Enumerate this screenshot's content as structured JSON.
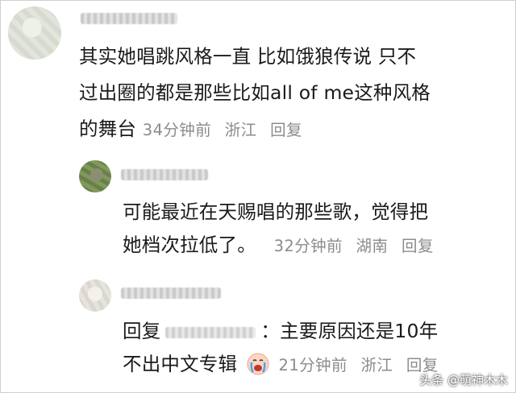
{
  "main_comment": {
    "line1": "其实她唱跳风格一直 比如饿狼传说  只不",
    "line2": "过出圈的都是那些比如all of me这种风格",
    "line3": "的舞台",
    "time": "34分钟前",
    "location": "浙江",
    "reply_label": "回复"
  },
  "reply_1": {
    "line1": "可能最近在天赐唱的那些歌，觉得把",
    "line2": "她档次拉低了。",
    "time": "32分钟前",
    "location": "湖南",
    "reply_label": "回复"
  },
  "reply_2": {
    "prefix": "回复",
    "colon": "：",
    "line1_rest": "主要原因还是10年",
    "line2": "不出中文专辑",
    "emoji": "crying-face-icon",
    "time": "21分钟前",
    "location": "浙江",
    "reply_label": "回复"
  },
  "watermark": "头条 @萌神木木"
}
